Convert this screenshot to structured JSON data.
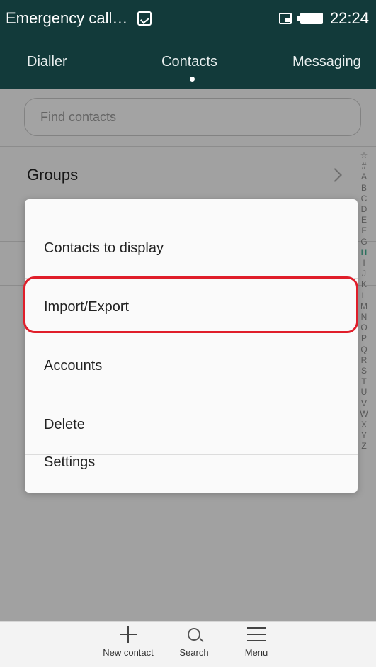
{
  "status_bar": {
    "title": "Emergency call…",
    "time": "22:24",
    "icons": [
      "image-icon",
      "sim-icon",
      "battery-icon"
    ]
  },
  "tabs": [
    {
      "label": "Dialler",
      "active": false
    },
    {
      "label": "Contacts",
      "active": true
    },
    {
      "label": "Messaging",
      "active": false
    }
  ],
  "search": {
    "placeholder": "Find contacts"
  },
  "groups": {
    "label": "Groups"
  },
  "index_letters": [
    "☆",
    "#",
    "A",
    "B",
    "C",
    "D",
    "E",
    "F",
    "G",
    "H",
    "I",
    "J",
    "K",
    "L",
    "M",
    "N",
    "O",
    "P",
    "Q",
    "R",
    "S",
    "T",
    "U",
    "V",
    "W",
    "X",
    "Y",
    "Z"
  ],
  "index_active": "H",
  "menu": {
    "items": [
      {
        "label": "Contacts to display"
      },
      {
        "label": "Import/Export",
        "highlighted": true
      },
      {
        "label": "Accounts"
      },
      {
        "label": "Delete"
      },
      {
        "label": "Settings"
      }
    ],
    "highlight_color": "#e01e2a"
  },
  "bottom_bar": {
    "new_contact": "New contact",
    "search": "Search",
    "menu": "Menu"
  },
  "colors": {
    "header_bg": "#123a3a",
    "index_active": "#1a9e7a"
  }
}
